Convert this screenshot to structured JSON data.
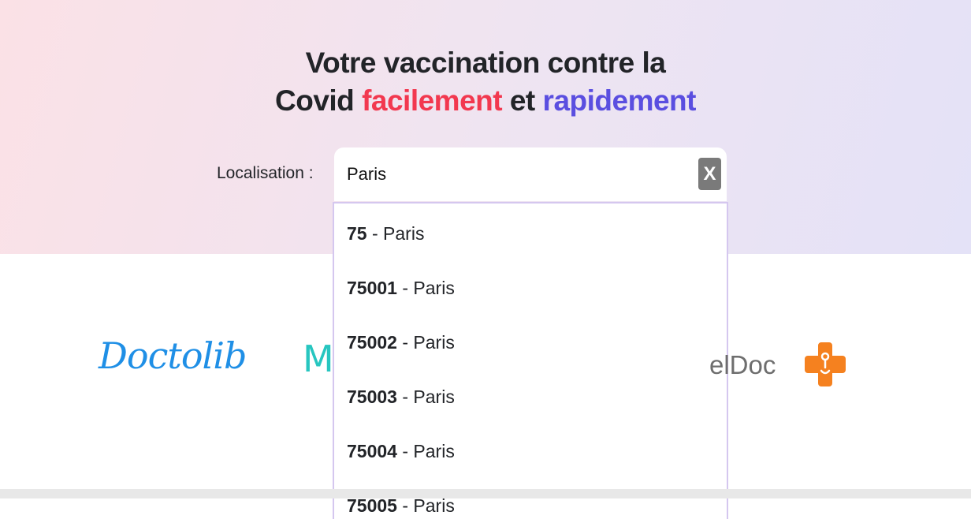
{
  "hero": {
    "title_line1": "Votre vaccination contre la",
    "title_line2_start": "Covid ",
    "title_accent1": "facilement",
    "title_mid": " et ",
    "title_accent2": "rapidement",
    "accent1_color": "#f2384f",
    "accent2_color": "#5a4ee0"
  },
  "search": {
    "label": "Localisation :",
    "value": "Paris",
    "clear_label": "X"
  },
  "dropdown": {
    "options": [
      {
        "code": "75",
        "sep": " - ",
        "city": "Paris"
      },
      {
        "code": "75001",
        "sep": " - ",
        "city": "Paris"
      },
      {
        "code": "75002",
        "sep": " - ",
        "city": "Paris"
      },
      {
        "code": "75003",
        "sep": " - ",
        "city": "Paris"
      },
      {
        "code": "75004",
        "sep": " - ",
        "city": "Paris"
      },
      {
        "code": "75005",
        "sep": " - ",
        "city": "Paris"
      }
    ]
  },
  "logos": {
    "doctolib": "Doctolib",
    "maiia": "M",
    "keldoc": "elDoc"
  }
}
